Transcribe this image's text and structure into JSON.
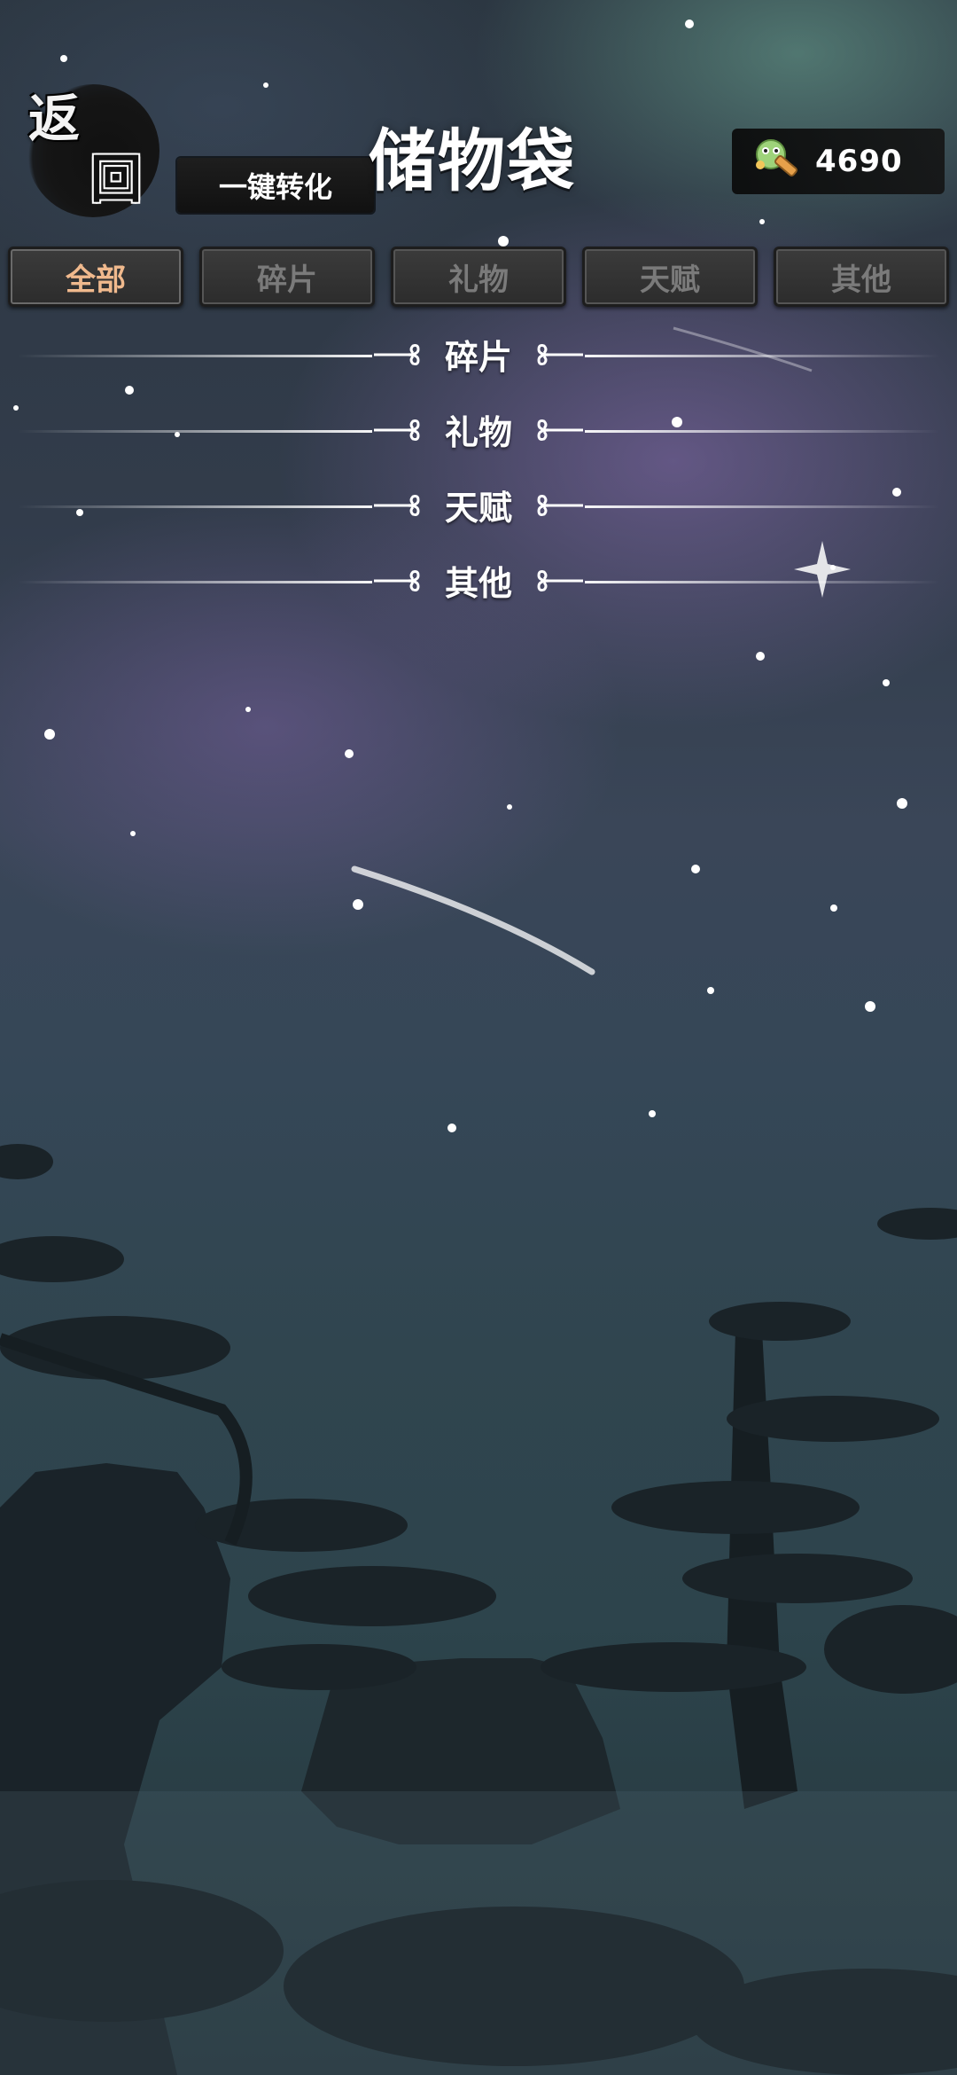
{
  "header": {
    "back_label_1": "返",
    "back_label_2": "回",
    "convert_label": "一键转化",
    "title": "储物袋"
  },
  "currency": {
    "icon": "scroll-currency-icon",
    "value": "4690"
  },
  "tabs": [
    {
      "label": "全部",
      "active": true
    },
    {
      "label": "碎片",
      "active": false
    },
    {
      "label": "礼物",
      "active": false
    },
    {
      "label": "天赋",
      "active": false
    },
    {
      "label": "其他",
      "active": false
    }
  ],
  "sections": [
    {
      "label": "碎片"
    },
    {
      "label": "礼物"
    },
    {
      "label": "天赋"
    },
    {
      "label": "其他"
    }
  ],
  "colors": {
    "active_tab_text": "#f0b98d",
    "inactive_tab_text": "#7a7a7a"
  }
}
